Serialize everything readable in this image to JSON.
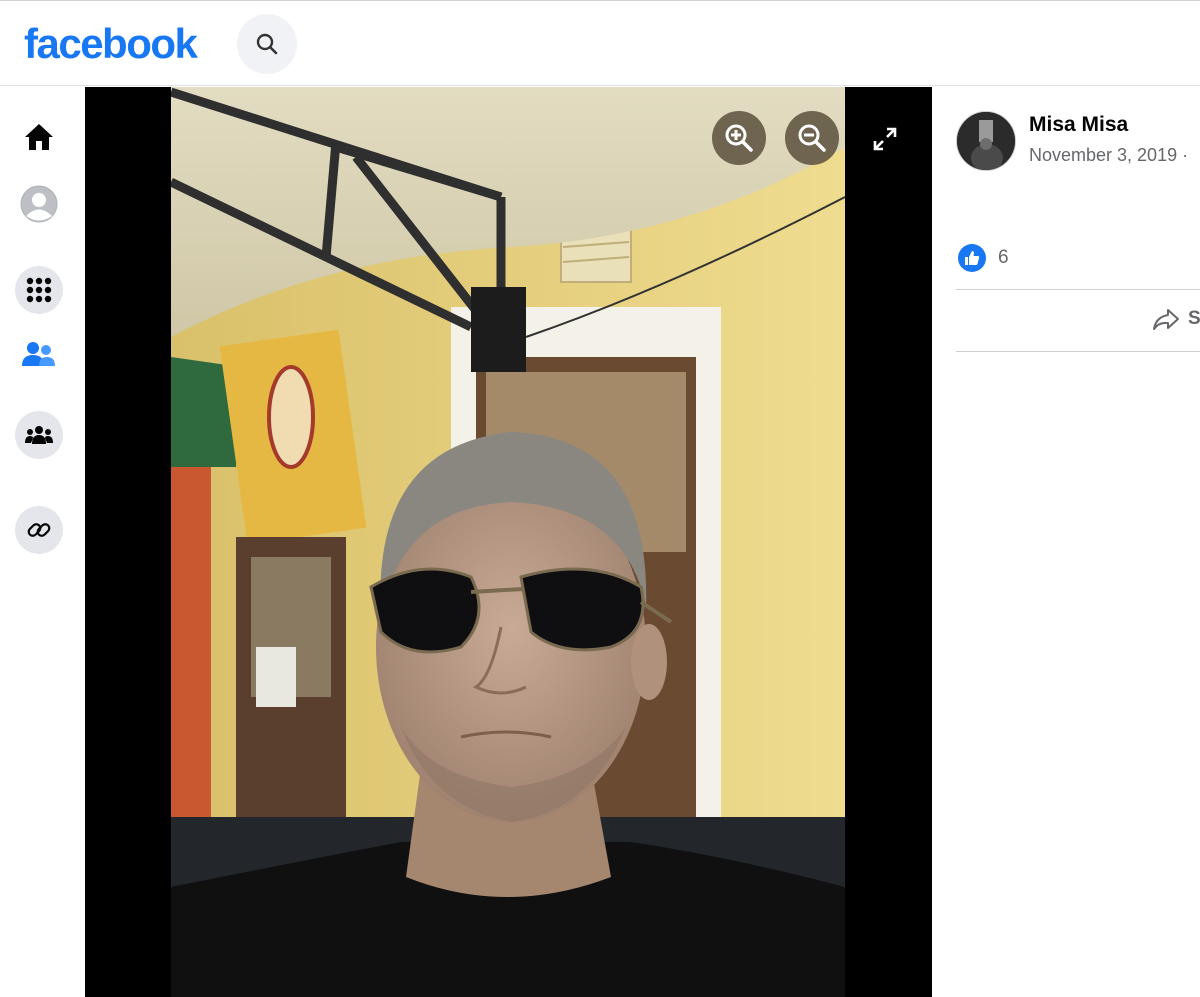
{
  "brand": {
    "logo_text": "facebook",
    "color": "#1877f2"
  },
  "header": {
    "search_icon": "search-icon"
  },
  "sidebar": {
    "items": [
      {
        "name": "home",
        "icon": "home-icon"
      },
      {
        "name": "profile",
        "icon": "profile-avatar-icon"
      },
      {
        "name": "menu",
        "icon": "grid-menu-icon"
      },
      {
        "name": "friends",
        "icon": "friends-icon"
      },
      {
        "name": "groups",
        "icon": "groups-icon"
      },
      {
        "name": "link",
        "icon": "link-icon"
      }
    ]
  },
  "viewer": {
    "zoom_in_icon": "zoom-in-icon",
    "zoom_out_icon": "zoom-out-icon",
    "fullscreen_icon": "expand-icon"
  },
  "post": {
    "author": "Misa Misa",
    "date": "November 3, 2019 ·",
    "like_count": "6",
    "share_label": "S"
  }
}
